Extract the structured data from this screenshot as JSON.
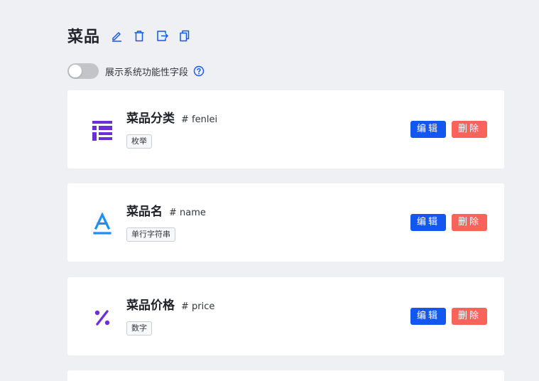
{
  "header": {
    "title": "菜品",
    "icons": [
      "edit-icon",
      "trash-icon",
      "export-icon",
      "copy-icon"
    ]
  },
  "toggle": {
    "label": "展示系统功能性字段",
    "checked": false
  },
  "fields": [
    {
      "name": "菜品分类",
      "key": "# fenlei",
      "type": "枚举",
      "icon": "enum-list-icon",
      "icon_color": "#6b2fd6",
      "edit_label": "编辑",
      "delete_label": "删除"
    },
    {
      "name": "菜品名",
      "key": "# name",
      "type": "单行字符串",
      "icon": "text-a-icon",
      "icon_color": "#1d8ef5",
      "edit_label": "编辑",
      "delete_label": "删除"
    },
    {
      "name": "菜品价格",
      "key": "# price",
      "type": "数字",
      "icon": "percent-number-icon",
      "icon_color": "#6b2fd6",
      "edit_label": "编辑",
      "delete_label": "删除"
    }
  ],
  "colors": {
    "accent": "#1456f0",
    "danger": "#f8635b",
    "background": "#eff0f4"
  }
}
